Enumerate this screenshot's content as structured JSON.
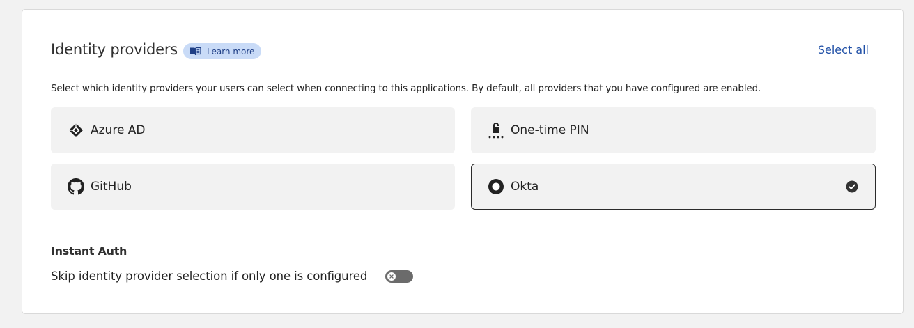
{
  "header": {
    "title": "Identity providers",
    "learn_more_label": "Learn more",
    "select_all_label": "Select all"
  },
  "description": "Select which identity providers your users can select when connecting to this applications. By default, all providers that you have configured are enabled.",
  "providers": [
    {
      "name": "Azure AD",
      "icon": "azure-ad-icon",
      "selected": false
    },
    {
      "name": "One-time PIN",
      "icon": "one-time-pin-icon",
      "selected": false
    },
    {
      "name": "GitHub",
      "icon": "github-icon",
      "selected": false
    },
    {
      "name": "Okta",
      "icon": "okta-icon",
      "selected": true
    }
  ],
  "instant_auth": {
    "title": "Instant Auth",
    "skip_label": "Skip identity provider selection if only one is configured",
    "toggle_on": false
  },
  "colors": {
    "accent_link": "#1f4fa6",
    "badge_bg": "#c9dbf7",
    "tile_bg": "#f2f2f2",
    "toggle_off": "#6b6b6b"
  }
}
